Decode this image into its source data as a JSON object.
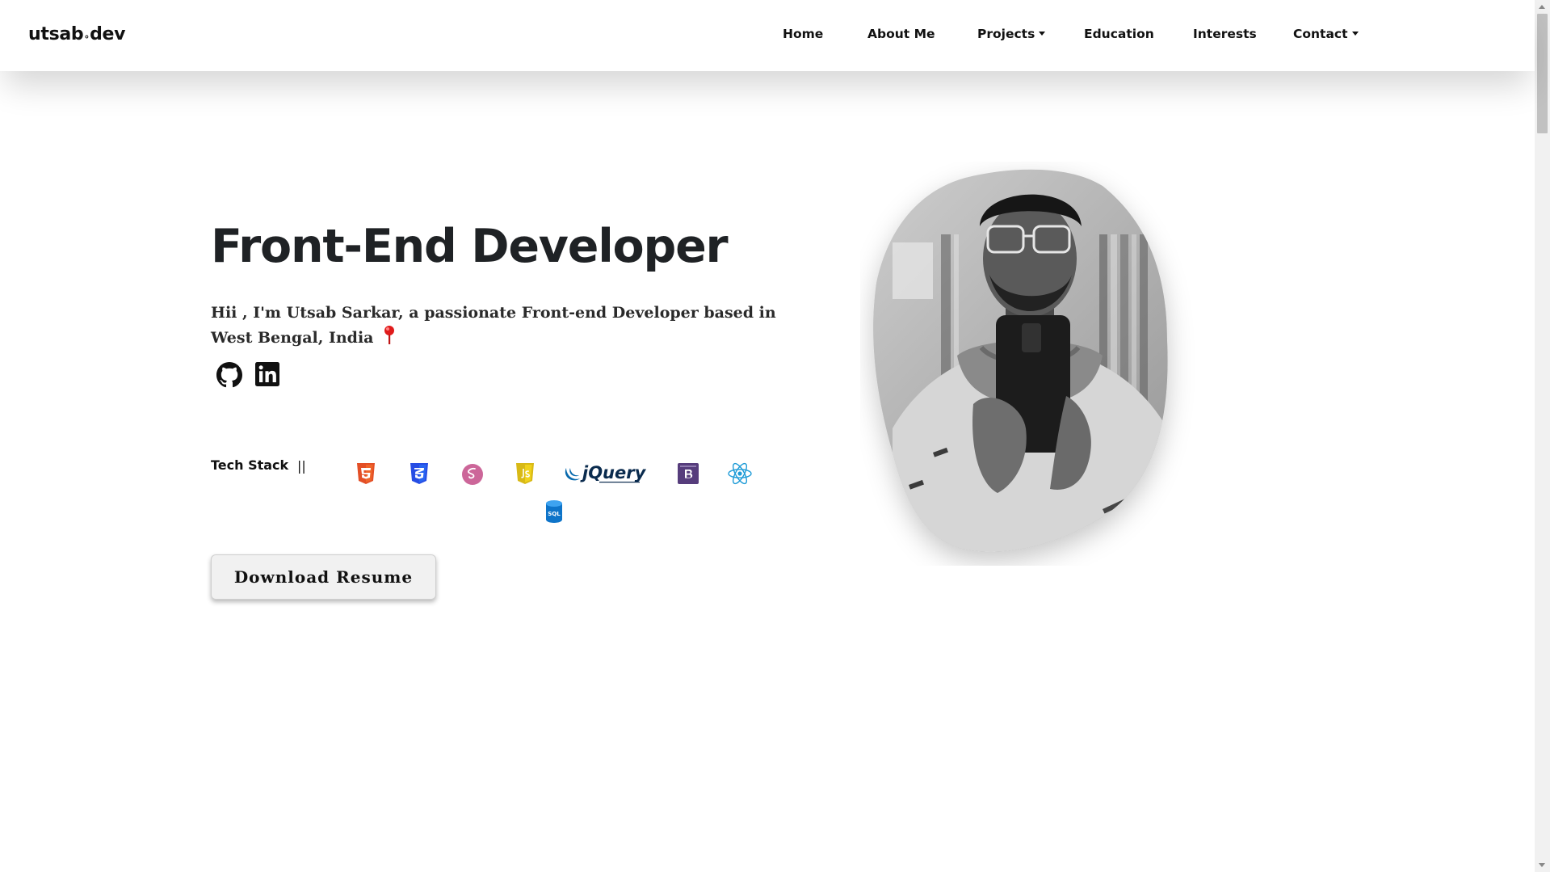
{
  "brand": {
    "name": "utsab",
    "separator": "°",
    "suffix": "dev"
  },
  "nav": {
    "home": "Home",
    "about": "About Me",
    "projects": "Projects",
    "education": "Education",
    "interests": "Interests",
    "contact": "Contact"
  },
  "hero": {
    "title": "Front-End Developer",
    "intro": "Hii , I'm Utsab Sarkar, a passionate Front-end Developer based in West Bengal, India",
    "tech_label": "Tech Stack",
    "tech_separator": "||",
    "resume_button": "Download Resume"
  },
  "social": {
    "icons": [
      "github-icon",
      "linkedin-icon"
    ]
  },
  "tech_stack": {
    "icons": [
      "html5-icon",
      "css3-icon",
      "sass-icon",
      "javascript-icon",
      "jquery-logo",
      "bootstrap-icon",
      "react-icon",
      "sql-icon"
    ],
    "jquery_text": "jQuery",
    "sql_text": "SQL"
  },
  "colors": {
    "html5": "#e34f26",
    "css3": "#264de4",
    "sass": "#cc6699",
    "javascript": "#d8b916",
    "jquery": "#0769ad",
    "bootstrap": "#563d7c",
    "react": "#1e9bd7",
    "sql": "#0e74c9",
    "pin": "#e01b1b"
  }
}
